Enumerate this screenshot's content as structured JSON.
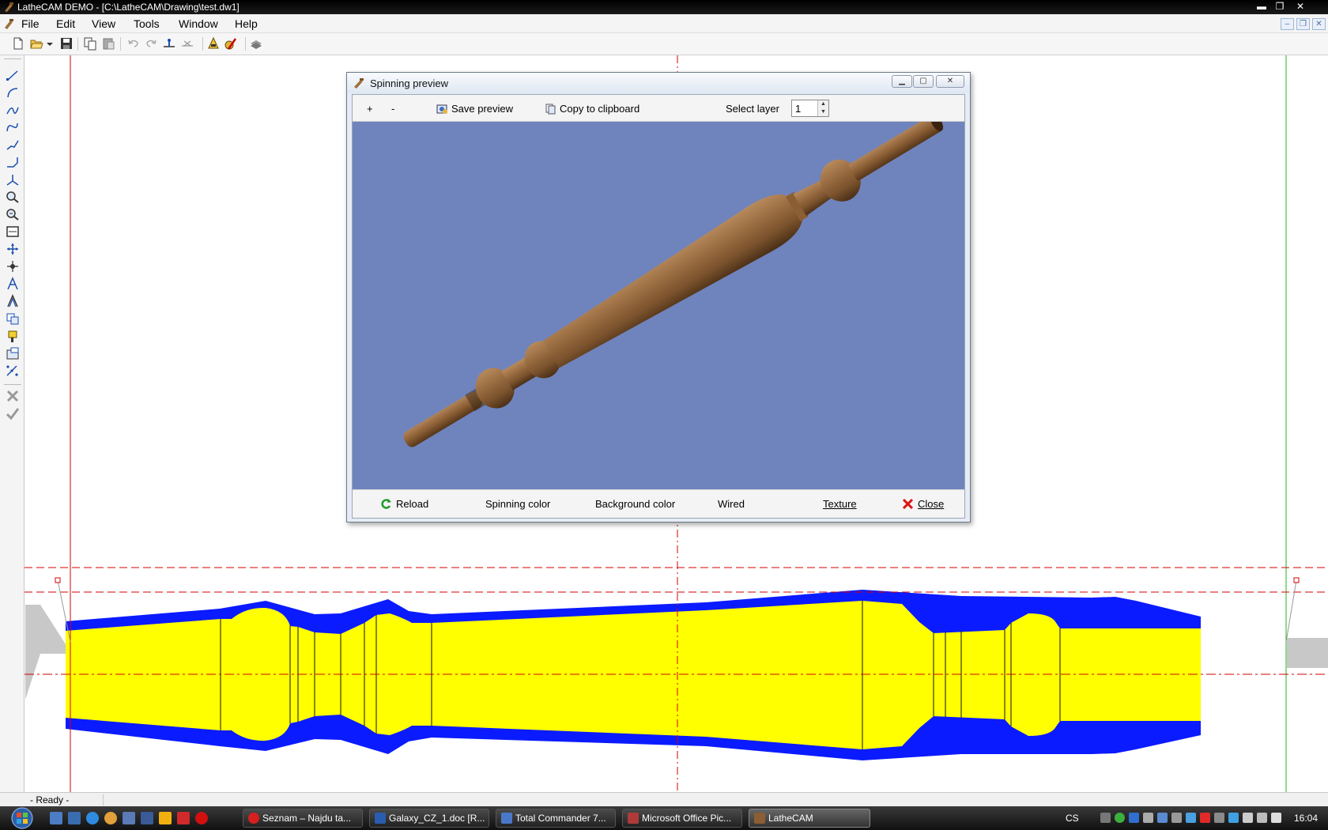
{
  "window": {
    "title": "LatheCAM DEMO  - [C:\\LatheCAM\\Drawing\\test.dw1]",
    "minimize_glyph": "▬",
    "restore_glyph": "❐",
    "close_glyph": "✕"
  },
  "menu": {
    "items": [
      "File",
      "Edit",
      "View",
      "Tools",
      "Window",
      "Help"
    ],
    "mdi_minimize": "–",
    "mdi_restore": "❐",
    "mdi_close": "✕"
  },
  "toolbar": {
    "icons": [
      "new-file-icon",
      "open-file-icon",
      "open-dropdown-icon",
      "save-icon",
      "copy-icon",
      "paste-icon",
      "undo-icon",
      "redo-icon",
      "insert-point-icon",
      "mirror-icon",
      "lathe-settings-icon",
      "edit-color-icon",
      "layers-icon"
    ]
  },
  "left_tools": [
    "line-tool",
    "arc-tool",
    "curve-tool",
    "spline-tool",
    "polyline-tool",
    "chamfer-tool",
    "node-tool",
    "zoom-in-tool",
    "zoom-out-tool",
    "zoom-all-tool",
    "move-tool",
    "center-tool",
    "cut-tool",
    "profile-tool",
    "copy-tool",
    "paint-tool",
    "export-tool",
    "points-tool",
    "delete-tool",
    "confirm-tool"
  ],
  "dialog": {
    "title": "Spinning preview",
    "toolbar": {
      "zoom_in": "+",
      "zoom_out": "-",
      "save_preview": "Save preview",
      "copy_clipboard": "Copy to clipboard",
      "select_layer_label": "Select layer",
      "select_layer_value": "1",
      "spin_up": "▲",
      "spin_down": "▼"
    },
    "footer": {
      "reload": "Reload",
      "spinning_color": "Spinning color",
      "background_color": "Background color",
      "wired": "Wired",
      "texture": "Texture",
      "close": "Close"
    },
    "preview_background": "#6f84bd",
    "wood_color": "#8b5e34"
  },
  "colors": {
    "stock": "#0b1bff",
    "profile": "#ffff00",
    "guide_red": "#d40000",
    "guide_green": "#22b022",
    "chuck": "#c8c8c8"
  },
  "status": {
    "text": "- Ready -"
  },
  "taskbar": {
    "tasks": [
      {
        "label": "Seznam – Najdu ta...",
        "icon_color": "#d61f1f"
      },
      {
        "label": "Galaxy_CZ_1.doc [R...",
        "icon_color": "#2a5db0"
      },
      {
        "label": "Total Commander 7...",
        "icon_color": "#4a78c8"
      },
      {
        "label": "Microsoft Office Pic...",
        "icon_color": "#b03a3a"
      },
      {
        "label": "LatheCAM",
        "icon_color": "#8b5e34"
      }
    ],
    "language": "CS",
    "clock": "16:04"
  }
}
